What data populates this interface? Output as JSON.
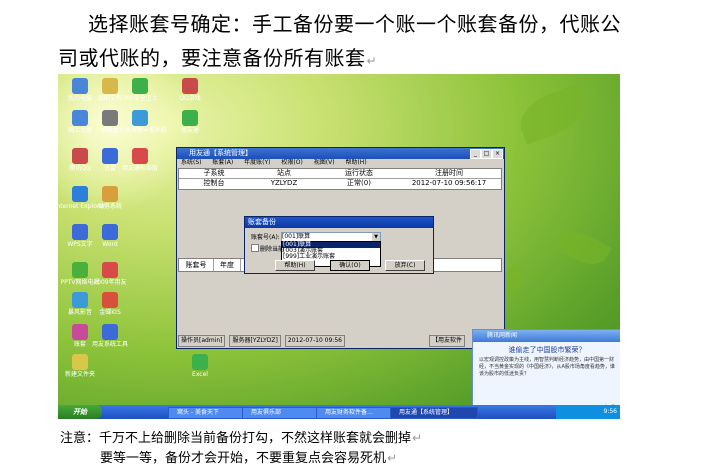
{
  "doc": {
    "para_line1": "选择账套号确定：手工备份要一个账一个账套备份，代账公",
    "para_line2": "司或代账的，要注意备份所有账套",
    "para_mark": "↵",
    "note_line1": "注意：千万不上给删除当前备份打勾，不然这样账套就会删掉",
    "note_line2": "要等一等，备份才会开始，不要重复点会容易死机"
  },
  "desktop": {
    "icons": [
      {
        "label": "我的电脑"
      },
      {
        "label": "我的文档"
      },
      {
        "label": "360安全卫士"
      },
      {
        "label": "QQ游戏"
      },
      {
        "label": "网上邻居"
      },
      {
        "label": "回收站"
      },
      {
        "label": "个人所得税申报系统"
      },
      {
        "label": "用友通"
      },
      {
        "label": "腾讯QQ"
      },
      {
        "label": "迅雷"
      },
      {
        "label": "用友通标准版"
      },
      {
        "label": "Internet Explorer"
      },
      {
        "label": "财务系统"
      },
      {
        "label": "WPS文字"
      },
      {
        "label": "Word"
      },
      {
        "label": "PPTV网络电视"
      },
      {
        "label": "2009年用友"
      },
      {
        "label": "暴风影音"
      },
      {
        "label": "金蝶KIS"
      },
      {
        "label": "账套"
      },
      {
        "label": "用友系统工具"
      },
      {
        "label": "新建文件夹"
      },
      {
        "label": "Excel"
      }
    ]
  },
  "main_window": {
    "title": "用友通【系统管理】",
    "menu": [
      "系统(S)",
      "账套(A)",
      "年度账(Y)",
      "权限(O)",
      "视图(V)",
      "帮助(H)"
    ],
    "grid_headers": [
      "子系统",
      "站点",
      "运行状态",
      "注册时间"
    ],
    "grid_row": [
      "控制台",
      "YZLYDZ",
      "正常(0)",
      "2012-07-10 09:56:17"
    ],
    "grid2_headers": [
      "账套号",
      "年度"
    ],
    "status": {
      "operator": "操作员[admin]",
      "server": "服务器[YZLYDZ]",
      "date": "2012-07-10 09:56",
      "brand": "【用友软件"
    }
  },
  "dialog": {
    "title": "账套备份",
    "account_label": "账套号(A):",
    "selected": "[001]联算",
    "options": [
      "[001]联算",
      "[003]演示账套",
      "[999]工业演示账套"
    ],
    "checkbox_label": "删除当前",
    "help": "帮助(H)",
    "ok": "确认(O)",
    "cancel": "放弃(C)"
  },
  "news": {
    "title": "腾讯网新闻",
    "headline": "谁偷走了中国股市繁荣？",
    "body": "以宏观调控政策为主线，用智慧判断经济趋势，由中国第一财经，不当黄金实现的《中国经济》，从A股市场角度看趋势，谁该为股市的低迷负责？",
    "more": "查看"
  },
  "taskbar": {
    "start": "开始",
    "tasks": [
      "窝头 - 美食天下",
      "用友俱乐部",
      "用友财务软件备...",
      "用友通【系统管理】"
    ],
    "clock": "9:56"
  }
}
